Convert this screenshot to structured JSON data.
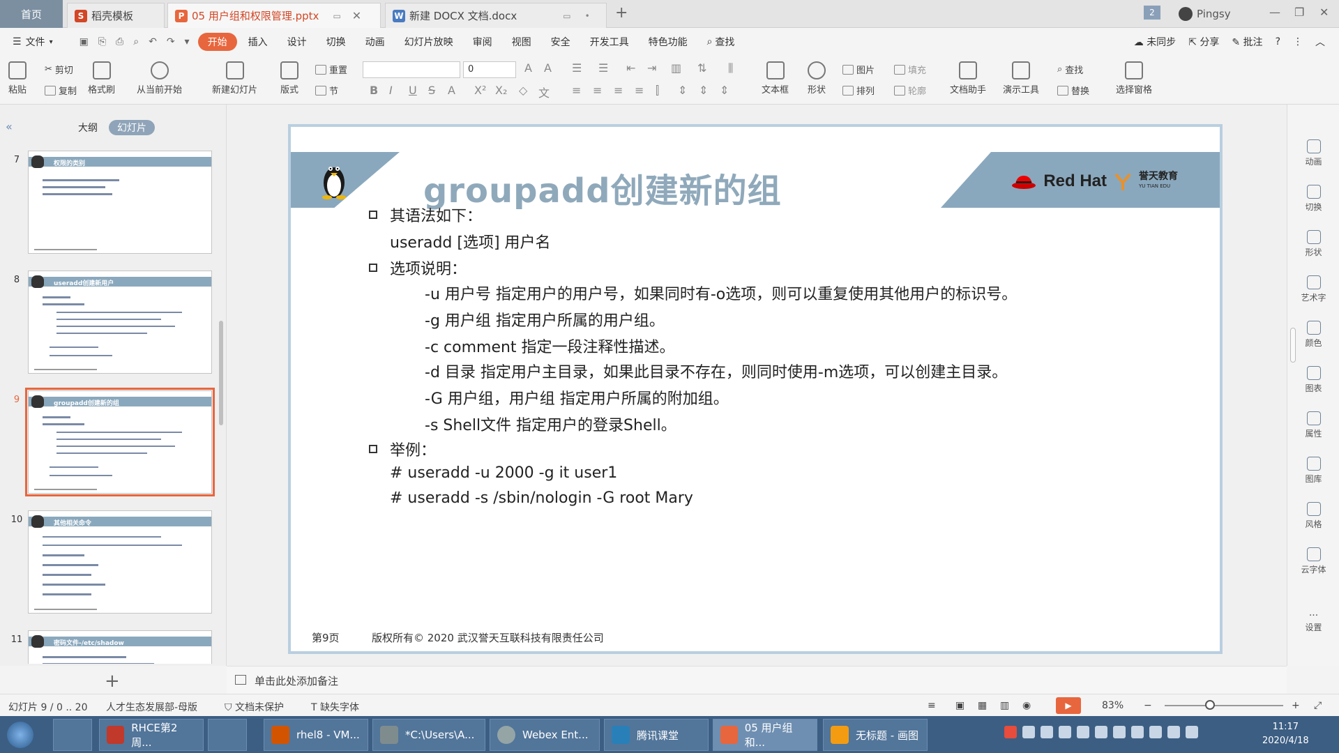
{
  "titlebar": {
    "home": "首页",
    "tabs": [
      {
        "label": "稻壳模板",
        "icon": "docer-icon",
        "color": "#d24726"
      },
      {
        "label": "05 用户组和权限管理.pptx",
        "icon": "pptx-icon",
        "color": "#e8663d"
      },
      {
        "label": "新建 DOCX 文档.docx",
        "icon": "docx-icon",
        "color": "#4a7bc0"
      }
    ],
    "user": "Pingsy",
    "badge": "2"
  },
  "menubar": {
    "file": "文件",
    "items": [
      "开始",
      "插入",
      "设计",
      "切换",
      "动画",
      "幻灯片放映",
      "审阅",
      "视图",
      "安全",
      "开发工具",
      "特色功能"
    ],
    "search": "查找",
    "right": [
      "未同步",
      "分享",
      "批注"
    ]
  },
  "ribbon": {
    "paste": "粘贴",
    "cut": "剪切",
    "copy": "复制",
    "format_painter": "格式刷",
    "play_from_current": "从当前开始",
    "new_slide": "新建幻灯片",
    "layout": "版式",
    "reset": "重置",
    "section": "节",
    "font_size": "0",
    "text_box": "文本框",
    "shape": "形状",
    "picture": "图片",
    "fill": "填充",
    "arrange": "排列",
    "outline": "轮廓",
    "doc_assistant": "文档助手",
    "presentation_tools": "演示工具",
    "find": "查找",
    "replace": "替换",
    "select_pane": "选择窗格"
  },
  "panel": {
    "tab_outline": "大纲",
    "tab_slides": "幻灯片",
    "thumbs": [
      {
        "num": "7",
        "title": "权限的类别"
      },
      {
        "num": "8",
        "title": "useradd创建新用户"
      },
      {
        "num": "9",
        "title": "groupadd创建新的组"
      },
      {
        "num": "10",
        "title": "其他相关命令"
      },
      {
        "num": "11",
        "title": "密码文件-/etc/shadow"
      }
    ]
  },
  "slide": {
    "title": "groupadd创建新的组",
    "brand": "Red Hat",
    "edu_cn": "誉天教育",
    "edu_en": "YU TIAN EDU",
    "lines": [
      "其语法如下：",
      "useradd  [选项]  用户名",
      "选项说明：",
      "-u 用户号 指定用户的用户号，如果同时有-o选项，则可以重复使用其他用户的标识号。",
      "-g 用户组 指定用户所属的用户组。",
      "-c comment 指定一段注释性描述。",
      "-d 目录 指定用户主目录，如果此目录不存在，则同时使用-m选项，可以创建主目录。",
      "-G 用户组，用户组 指定用户所属的附加组。",
      "-s Shell文件 指定用户的登录Shell。",
      "举例：",
      "# useradd -u 2000 -g it  user1",
      "# useradd -s /sbin/nologin  -G root  Mary"
    ],
    "page": "第9页",
    "copyright": "版权所有© 2020 武汉誉天互联科技有限责任公司"
  },
  "rightbar": [
    "动画",
    "切换",
    "形状",
    "艺术字",
    "颜色",
    "图表",
    "属性",
    "图库",
    "风格",
    "云字体",
    "设置"
  ],
  "notes": "单击此处添加备注",
  "status": {
    "slide_count": "幻灯片 9 / 0 .. 20",
    "template": "人才生态发展部-母版",
    "protect": "文档未保护",
    "missing_font": "缺失字体",
    "zoom": "83%"
  },
  "taskbar": {
    "items": [
      "RHCE第2周...",
      "rhel8 - VM...",
      "*C:\\Users\\A...",
      "Webex Ent...",
      "腾讯课堂",
      "05 用户组和...",
      "无标题 - 画图"
    ],
    "time": "11:17",
    "date": "2020/4/18"
  }
}
